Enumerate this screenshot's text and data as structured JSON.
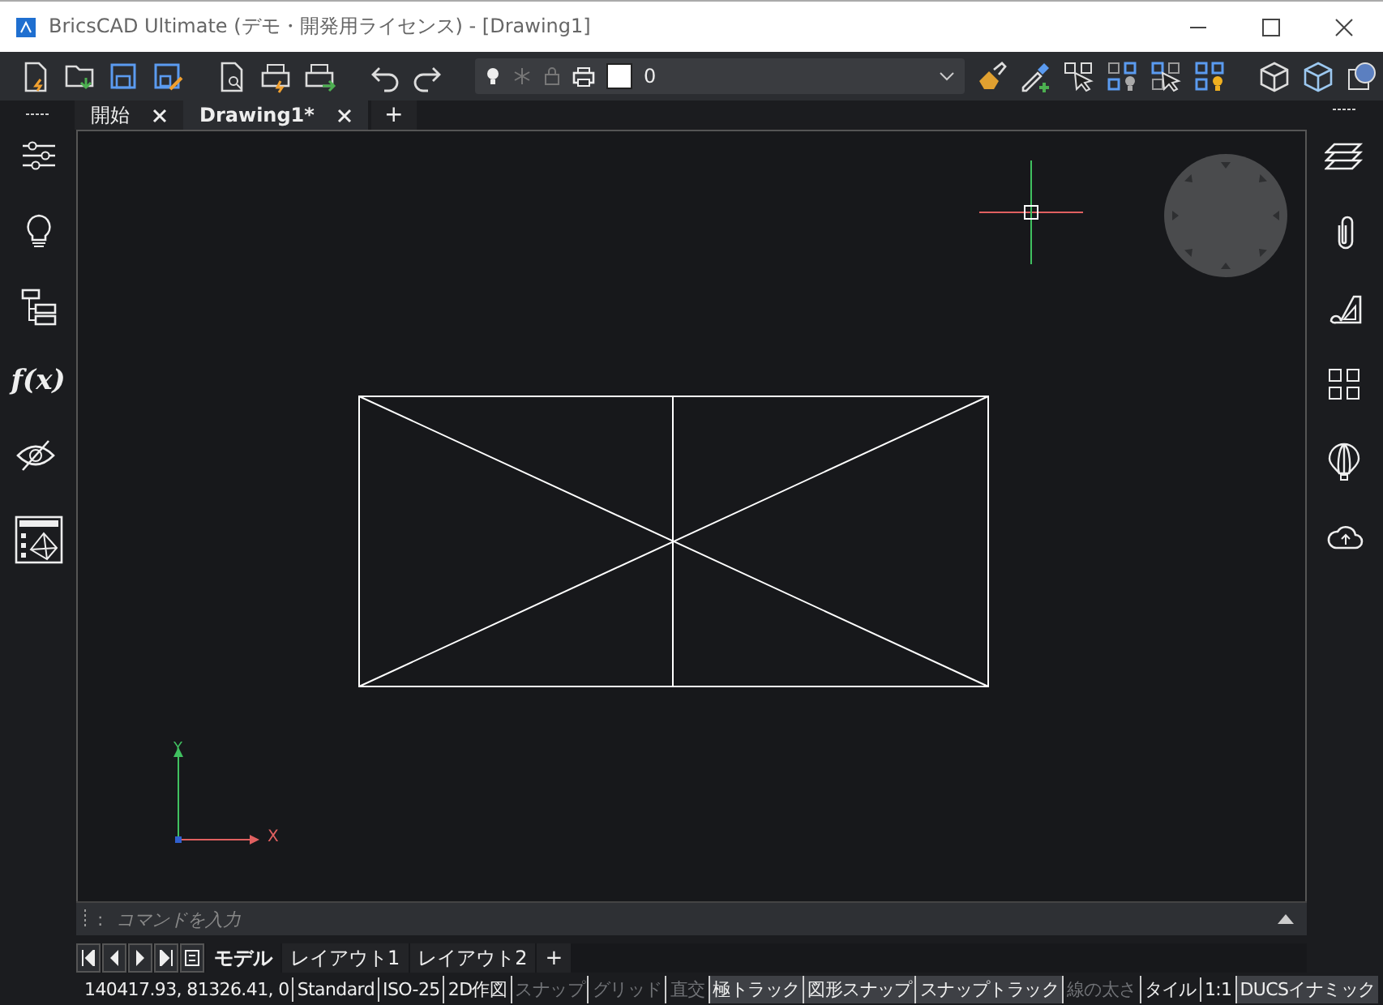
{
  "window": {
    "title": "BricsCAD Ultimate (デモ・開発用ライセンス) - [Drawing1]"
  },
  "toolbar": {
    "layer_name": "0"
  },
  "document_tabs": [
    {
      "label": "開始",
      "selected": false
    },
    {
      "label": "Drawing1*",
      "selected": true
    }
  ],
  "new_document_tab": "+",
  "left_sidebar": {
    "function_label": "f(x)"
  },
  "ucs": {
    "x_label": "X",
    "y_label": "Y"
  },
  "command_line": {
    "prompt": ":",
    "placeholder": "コマンドを入力"
  },
  "layout_tabs": [
    {
      "label": "モデル",
      "selected": true
    },
    {
      "label": "レイアウト1",
      "selected": false
    },
    {
      "label": "レイアウト2",
      "selected": false
    }
  ],
  "new_layout_tab": "+",
  "status_bar": [
    {
      "label": "140417.93, 81326.41, 0",
      "kind": "info"
    },
    {
      "label": "Standard",
      "kind": "info"
    },
    {
      "label": "ISO-25",
      "kind": "info"
    },
    {
      "label": "2D作図",
      "kind": "info"
    },
    {
      "label": "スナップ",
      "kind": "toggle",
      "on": false
    },
    {
      "label": "グリッド",
      "kind": "toggle",
      "on": false
    },
    {
      "label": "直交",
      "kind": "toggle",
      "on": false
    },
    {
      "label": "極トラック",
      "kind": "toggle",
      "on": true
    },
    {
      "label": "図形スナップ",
      "kind": "toggle",
      "on": true
    },
    {
      "label": "スナップトラック",
      "kind": "toggle",
      "on": true
    },
    {
      "label": "線の太さ",
      "kind": "toggle",
      "on": false
    },
    {
      "label": "タイル",
      "kind": "info"
    },
    {
      "label": "1:1",
      "kind": "info"
    },
    {
      "label": "DUCSイナミック",
      "kind": "toggle",
      "on": true
    }
  ]
}
